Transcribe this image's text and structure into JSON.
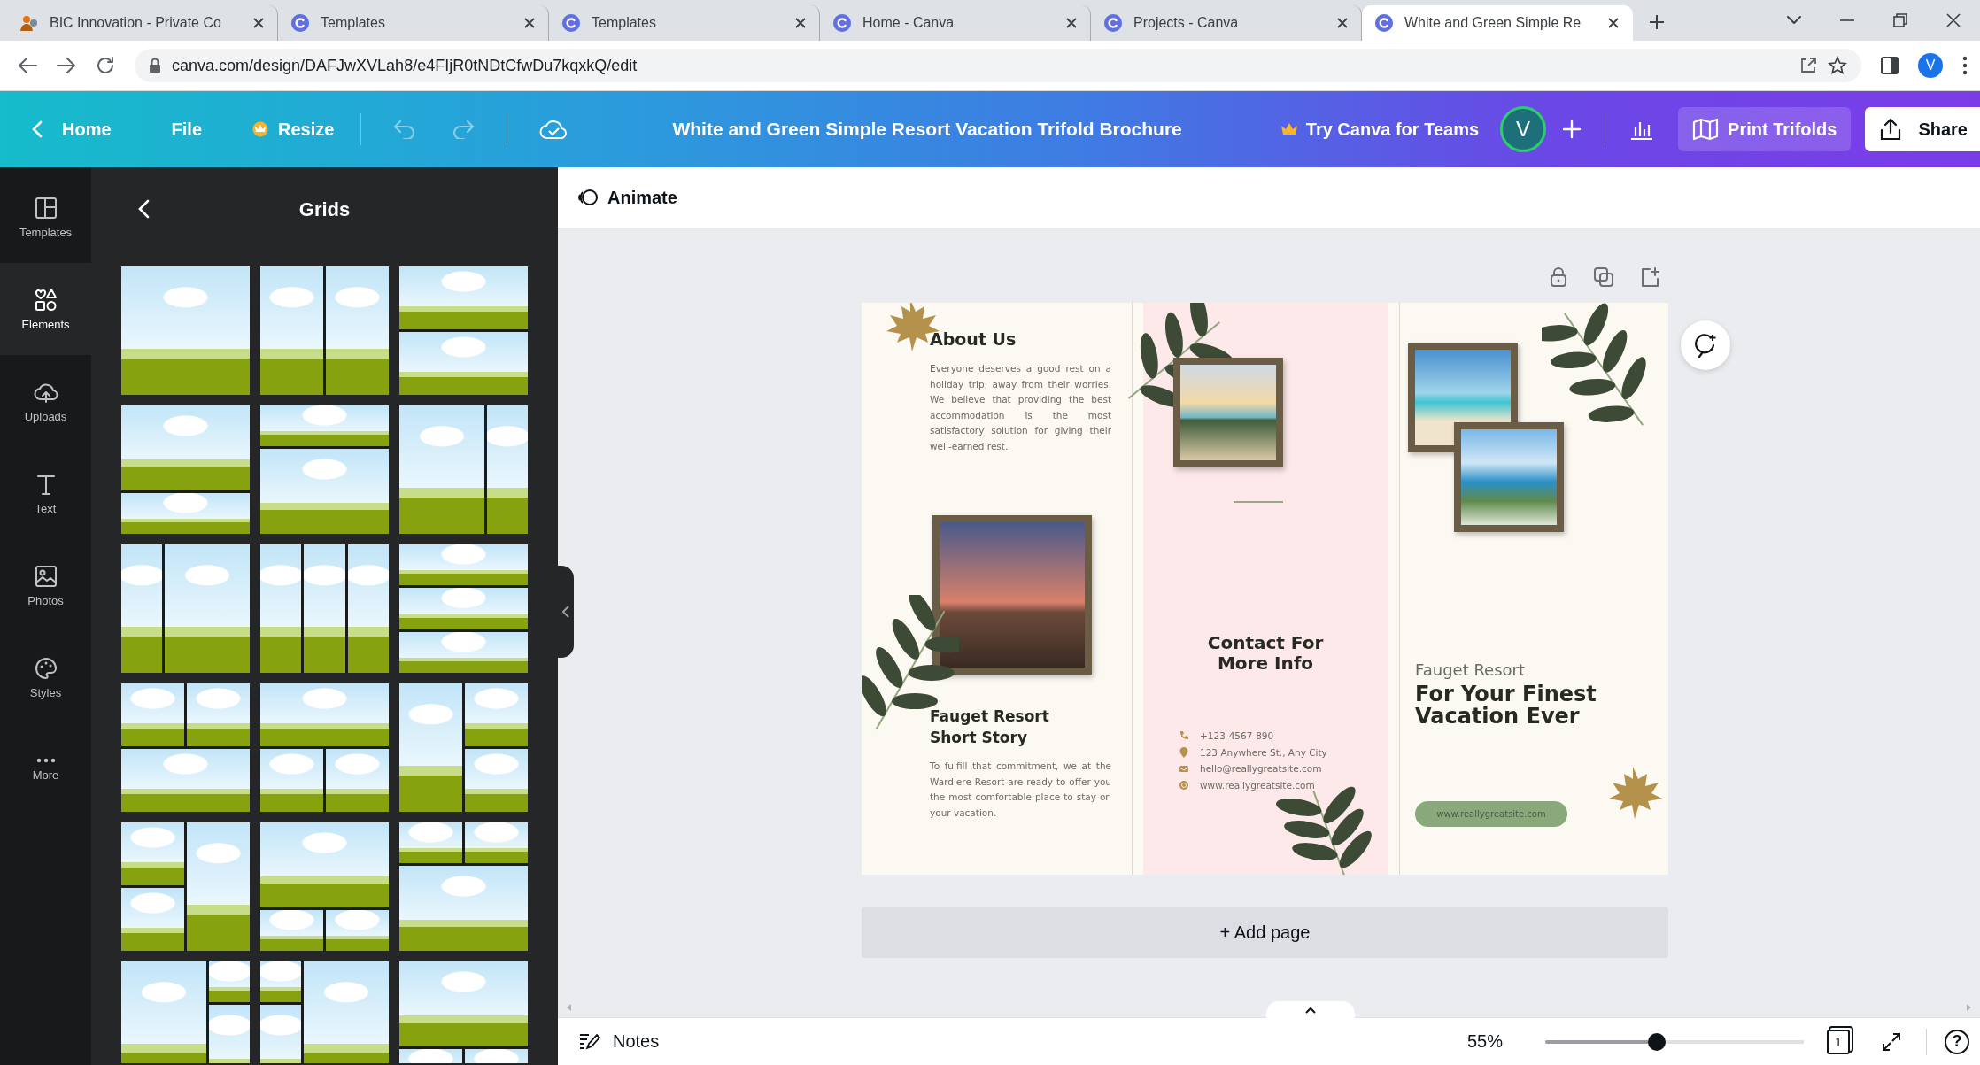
{
  "browser": {
    "tabs": [
      {
        "kind": "site",
        "title": "BIC Innovation - Private Co",
        "selected": false
      },
      {
        "kind": "canva",
        "title": "Templates",
        "selected": false
      },
      {
        "kind": "canva",
        "title": "Templates",
        "selected": false
      },
      {
        "kind": "canva",
        "title": "Home - Canva",
        "selected": false
      },
      {
        "kind": "canva",
        "title": "Projects - Canva",
        "selected": false
      },
      {
        "kind": "canva",
        "title": "White and Green Simple Re",
        "selected": true
      }
    ],
    "url": "canva.com/design/DAFJwXVLah8/e4FIjR0tNDtCfwDu7kqxkQ/edit",
    "profile_initial": "V"
  },
  "toolbar": {
    "home": "Home",
    "file": "File",
    "resize": "Resize",
    "document_title": "White and Green Simple Resort Vacation Trifold Brochure",
    "teams": "Try Canva for Teams",
    "avatar_initial": "V",
    "print": "Print Trifolds",
    "share": "Share"
  },
  "sidebar": {
    "items": [
      {
        "kind": "templates",
        "label": "Templates",
        "selected": false
      },
      {
        "kind": "elements",
        "label": "Elements",
        "selected": true
      },
      {
        "kind": "uploads",
        "label": "Uploads",
        "selected": false
      },
      {
        "kind": "text",
        "label": "Text",
        "selected": false
      },
      {
        "kind": "photos",
        "label": "Photos",
        "selected": false
      },
      {
        "kind": "styles",
        "label": "Styles",
        "selected": false
      },
      {
        "kind": "more",
        "label": "More",
        "selected": false
      }
    ]
  },
  "panel": {
    "title": "Grids"
  },
  "editor": {
    "animate": "Animate",
    "brochure": {
      "about_title": "About Us",
      "about_text": "Everyone deserves a good rest on a holiday trip, away from their worries. We believe that providing the best accommodation is the most satisfactory solution for giving their well-earned rest.",
      "story_title": "Fauget Resort Short Story",
      "story_text": "To fulfill that commitment, we at the Wardiere Resort are ready to offer you the most comfortable place to stay on your vacation.",
      "contact_title": "Contact For More Info",
      "contacts": [
        {
          "kind": "phone",
          "text": "+123-4567-890"
        },
        {
          "kind": "location",
          "text": "123 Anywhere St., Any City"
        },
        {
          "kind": "email",
          "text": "hello@reallygreatsite.com"
        },
        {
          "kind": "web",
          "text": "www.reallygreatsite.com"
        }
      ],
      "resort_name": "Fauget Resort",
      "headline": "For Your Finest Vacation Ever",
      "website_button": "www.reallygreatsite.com"
    },
    "add_page": "+ Add page"
  },
  "bottom_bar": {
    "notes": "Notes",
    "zoom": "55%",
    "zoom_slider": {
      "level": 0.43
    },
    "page_count": "1",
    "help": "?"
  }
}
